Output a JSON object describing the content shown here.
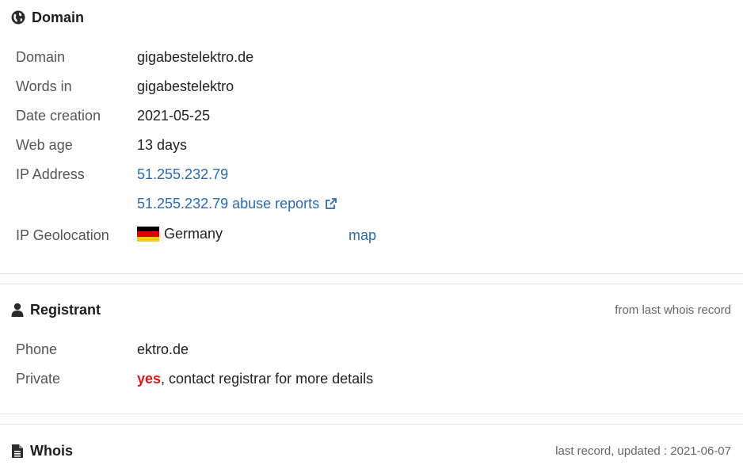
{
  "domain_section": {
    "title": "Domain",
    "rows": [
      {
        "label": "Domain",
        "value": "gigabestelektro.de"
      },
      {
        "label": "Words in",
        "value": "gigabestelektro"
      },
      {
        "label": "Date creation",
        "value": "2021-05-25"
      },
      {
        "label": "Web age",
        "value": "13 days"
      },
      {
        "label": "IP Address",
        "value": "51.255.232.79"
      }
    ],
    "abuse_link": "51.255.232.79 abuse reports",
    "geo": {
      "label": "IP Geolocation",
      "country": "Germany",
      "map_link": "map"
    }
  },
  "registrant_section": {
    "title": "Registrant",
    "meta": "from last whois record",
    "phone": {
      "label": "Phone",
      "value": "ektro.de"
    },
    "private": {
      "label": "Private",
      "highlight": "yes",
      "rest": ", contact registrar for more details"
    }
  },
  "whois_section": {
    "title": "Whois",
    "meta": "last record, updated : 2021-06-07"
  },
  "colors": {
    "link": "#2d6aab",
    "highlight": "#d11a1a"
  }
}
